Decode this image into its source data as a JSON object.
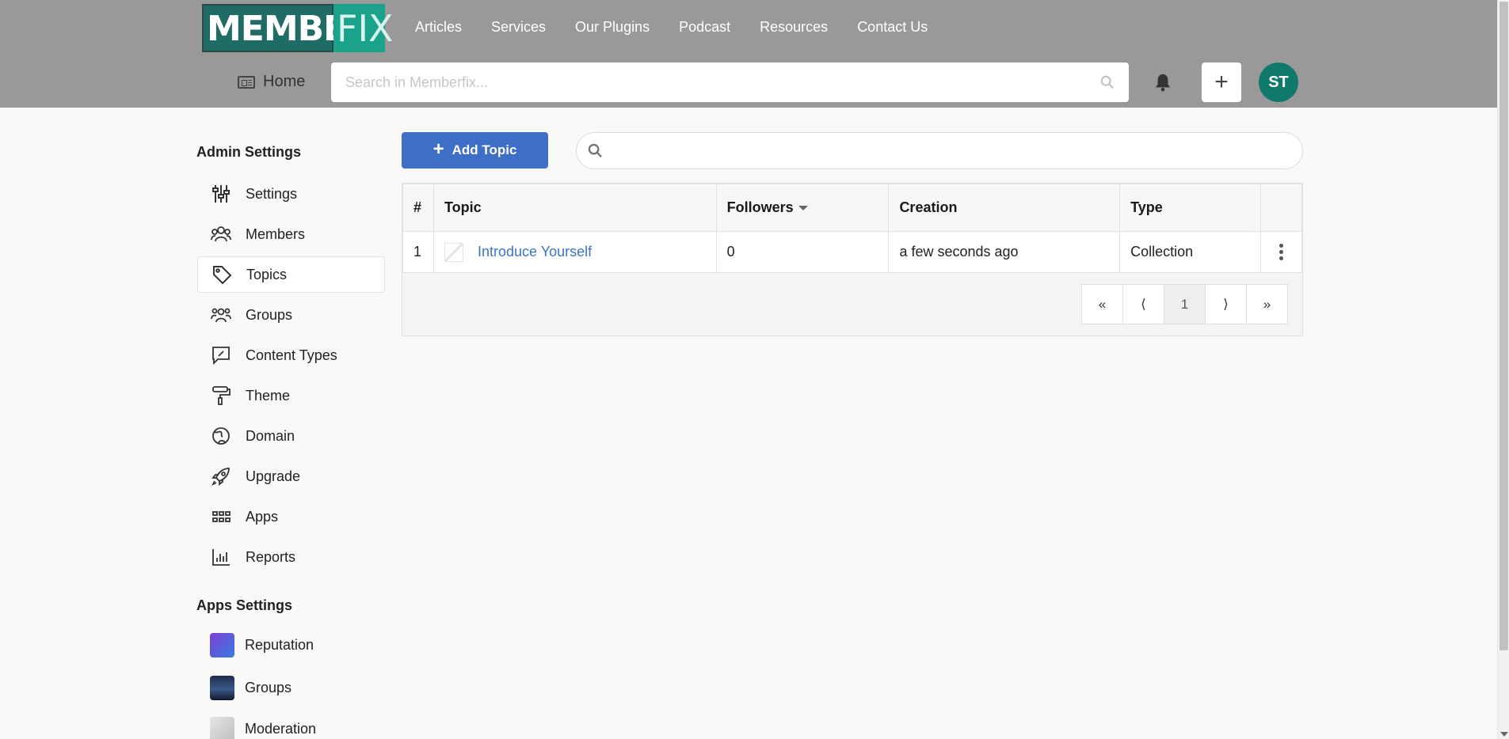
{
  "header": {
    "logo_member": "MEMBER",
    "logo_fix": "FIX",
    "nav": [
      "Articles",
      "Services",
      "Our Plugins",
      "Podcast",
      "Resources",
      "Contact Us"
    ],
    "home_label": "Home",
    "search_placeholder": "Search in Memberfix...",
    "create_symbol": "+",
    "avatar_initials": "ST",
    "brand_color": "#1f6b66",
    "avatar_color": "#0f7a6b"
  },
  "sidebar": {
    "admin_heading": "Admin Settings",
    "items": [
      {
        "label": "Settings",
        "icon": "sliders-icon"
      },
      {
        "label": "Members",
        "icon": "members-icon"
      },
      {
        "label": "Topics",
        "icon": "tag-icon",
        "active": true
      },
      {
        "label": "Groups",
        "icon": "groups-icon"
      },
      {
        "label": "Content Types",
        "icon": "content-types-icon"
      },
      {
        "label": "Theme",
        "icon": "paint-roller-icon"
      },
      {
        "label": "Domain",
        "icon": "globe-icon"
      },
      {
        "label": "Upgrade",
        "icon": "rocket-icon"
      },
      {
        "label": "Apps",
        "icon": "apps-grid-icon"
      },
      {
        "label": "Reports",
        "icon": "chart-icon"
      }
    ],
    "apps_heading": "Apps Settings",
    "apps": [
      {
        "label": "Reputation"
      },
      {
        "label": "Groups"
      },
      {
        "label": "Moderation"
      }
    ]
  },
  "main": {
    "add_button_label": "Add Topic",
    "accent_color": "#3d6fc6",
    "table": {
      "headers": [
        "#",
        "Topic",
        "Followers",
        "Creation",
        "Type",
        ""
      ],
      "rows": [
        {
          "num": "1",
          "topic": "Introduce Yourself",
          "followers": "0",
          "creation": "a few seconds ago",
          "type": "Collection"
        }
      ]
    },
    "pagination": [
      "«",
      "⟨",
      "1",
      "⟩",
      "»"
    ]
  }
}
